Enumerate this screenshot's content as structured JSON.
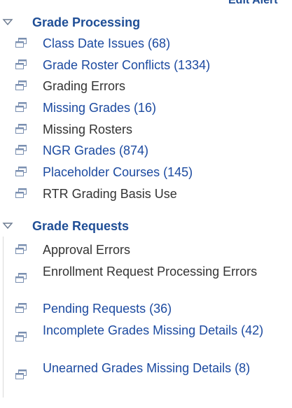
{
  "header_link": "Edit Alert",
  "sections": [
    {
      "title": "Grade Processing",
      "items": [
        {
          "label": "Class Date Issues (68)",
          "is_link": true
        },
        {
          "label": "Grade Roster Conflicts (1334)",
          "is_link": true
        },
        {
          "label": "Grading Errors",
          "is_link": false
        },
        {
          "label": "Missing Grades (16)",
          "is_link": true
        },
        {
          "label": "Missing Rosters",
          "is_link": false
        },
        {
          "label": "NGR Grades (874)",
          "is_link": true
        },
        {
          "label": "Placeholder Courses (145)",
          "is_link": true
        },
        {
          "label": "RTR Grading Basis Use",
          "is_link": false
        }
      ]
    },
    {
      "title": "Grade Requests",
      "items": [
        {
          "label": "Approval Errors",
          "is_link": false
        },
        {
          "label": "Enrollment Request Processing Errors",
          "is_link": false
        },
        {
          "label": "Pending Requests (36)",
          "is_link": true
        },
        {
          "label": "Incomplete Grades Missing Details (42)",
          "is_link": true
        },
        {
          "label": "Unearned Grades Missing Details (8)",
          "is_link": true
        }
      ]
    }
  ],
  "colors": {
    "link": "#1c4aa0",
    "plain_text": "#333333",
    "header": "#1f4e96",
    "icon": "#7a8fb0"
  },
  "icons": {
    "collapse": "triangle-down-icon",
    "item": "window-icon"
  }
}
